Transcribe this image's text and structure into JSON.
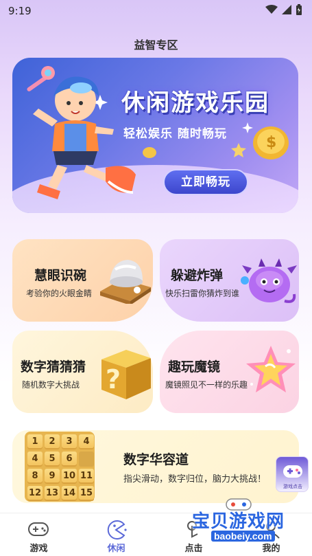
{
  "status_bar": {
    "time": "9:19"
  },
  "page_title": "益智专区",
  "banner": {
    "title": "休闲游戏乐园",
    "subtitle": "轻松娱乐 随时畅玩",
    "button_label": "立即畅玩"
  },
  "games": [
    {
      "title": "慧眼识碗",
      "subtitle": "考验你的火眼金睛",
      "icon": "bowl-cup-icon"
    },
    {
      "title": "躲避炸弹",
      "subtitle": "快乐扫雷你猜炸到谁",
      "icon": "purple-monster-icon"
    },
    {
      "title": "数字猜猜猜",
      "subtitle": "随机数字大挑战",
      "icon": "question-box-icon"
    },
    {
      "title": "趣玩魔镜",
      "subtitle": "魔镜照见不一样的乐趣",
      "icon": "star-mirror-icon"
    }
  ],
  "featured": {
    "title": "数字华容道",
    "subtitle": "指尖滑动，数字归位，脑力大挑战！",
    "tiles": [
      "1",
      "2",
      "3",
      "4",
      "4",
      "5",
      "6",
      "",
      "8",
      "9",
      "10",
      "11",
      "12",
      "13",
      "14",
      "15"
    ]
  },
  "float_widget": {
    "label": "游戏点击"
  },
  "tabs": [
    {
      "label": "游戏",
      "icon": "gamepad-icon"
    },
    {
      "label": "休闲",
      "icon": "pacman-icon"
    },
    {
      "label": "点击",
      "icon": "tap-icon"
    },
    {
      "label": "我的",
      "icon": "profile-icon"
    }
  ],
  "watermark": {
    "text": "宝贝游戏网",
    "url": "baobeiy.com"
  },
  "colors": {
    "accent": "#5b69d8",
    "banner_start": "#3f63d8",
    "watermark": "#2b66e0"
  }
}
